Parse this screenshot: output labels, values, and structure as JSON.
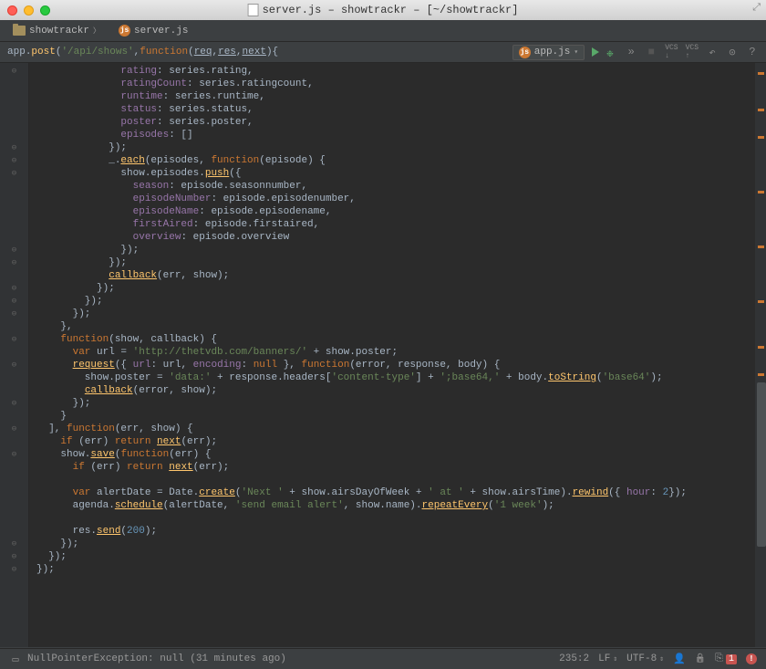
{
  "window": {
    "title": "server.js – showtrackr – [~/showtrackr]"
  },
  "tabs": {
    "project": "showtrackr",
    "file": "server.js"
  },
  "breadcrumb": {
    "app": "app",
    "method": "post",
    "route": "'/api/shows'",
    "fn": "function",
    "p1": "req",
    "p2": "res",
    "p3": "next",
    "brace": "{"
  },
  "toolbar": {
    "run_config": "app.js",
    "vcs": "VCS"
  },
  "code": {
    "lines": [
      "              rating: series.rating,",
      "              ratingCount: series.ratingcount,",
      "              runtime: series.runtime,",
      "              status: series.status,",
      "              poster: series.poster,",
      "              episodes: []",
      "            });",
      "            _.each(episodes, function(episode) {",
      "              show.episodes.push({",
      "                season: episode.seasonnumber,",
      "                episodeNumber: episode.episodenumber,",
      "                episodeName: episode.episodename,",
      "                firstAired: episode.firstaired,",
      "                overview: episode.overview",
      "              });",
      "            });",
      "            callback(err, show);",
      "          });",
      "        });",
      "      });",
      "    },",
      "    function(show, callback) {",
      "      var url = 'http://thetvdb.com/banners/' + show.poster;",
      "      request({ url: url, encoding: null }, function(error, response, body) {",
      "        show.poster = 'data:' + response.headers['content-type'] + ';base64,' + body.toString('base64');",
      "        callback(error, show);",
      "      });",
      "    }",
      "  ], function(err, show) {",
      "    if (err) return next(err);",
      "    show.save(function(err) {",
      "      if (err) return next(err);",
      "",
      "      var alertDate = Date.create('Next ' + show.airsDayOfWeek + ' at ' + show.airsTime).rewind({ hour: 2});",
      "      agenda.schedule(alertDate, 'send email alert', show.name).repeatEvery('1 week');",
      "",
      "      res.send(200);",
      "    });",
      "  });",
      "});"
    ]
  },
  "status": {
    "message": "NullPointerException: null (31 minutes ago)",
    "position": "235:2",
    "line_sep": "LF",
    "encoding": "UTF-8",
    "errors": "1"
  }
}
